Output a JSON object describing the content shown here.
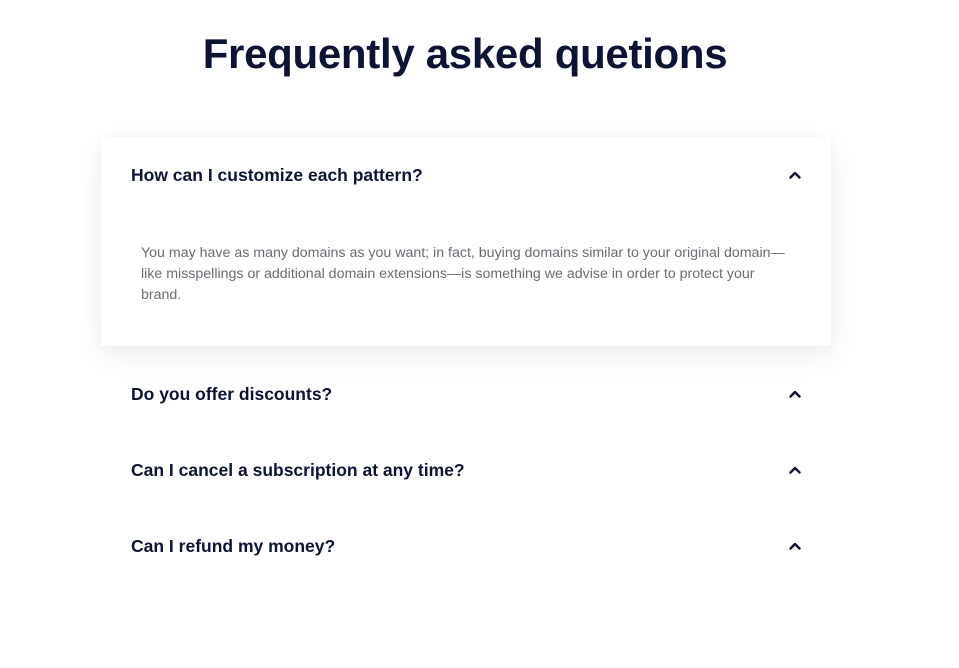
{
  "page": {
    "title": "Frequently asked quetions"
  },
  "faq": {
    "items": [
      {
        "question": "How can I customize each pattern?",
        "answer": "You may have as many domains as you want; in fact, buying domains similar to your original domain—like misspellings or additional domain extensions—is something we advise in order to protect your brand.",
        "expanded": true,
        "icon": "chevron-up-icon"
      },
      {
        "question": "Do you offer discounts?",
        "expanded": false,
        "icon": "chevron-up-icon"
      },
      {
        "question": "Can I cancel a subscription at any time?",
        "expanded": false,
        "icon": "chevron-up-icon"
      },
      {
        "question": "Can I refund my money?",
        "expanded": false,
        "icon": "chevron-up-icon"
      }
    ]
  },
  "colors": {
    "heading": "#0b1533",
    "body_text": "#6b6b73",
    "background": "#ffffff"
  }
}
